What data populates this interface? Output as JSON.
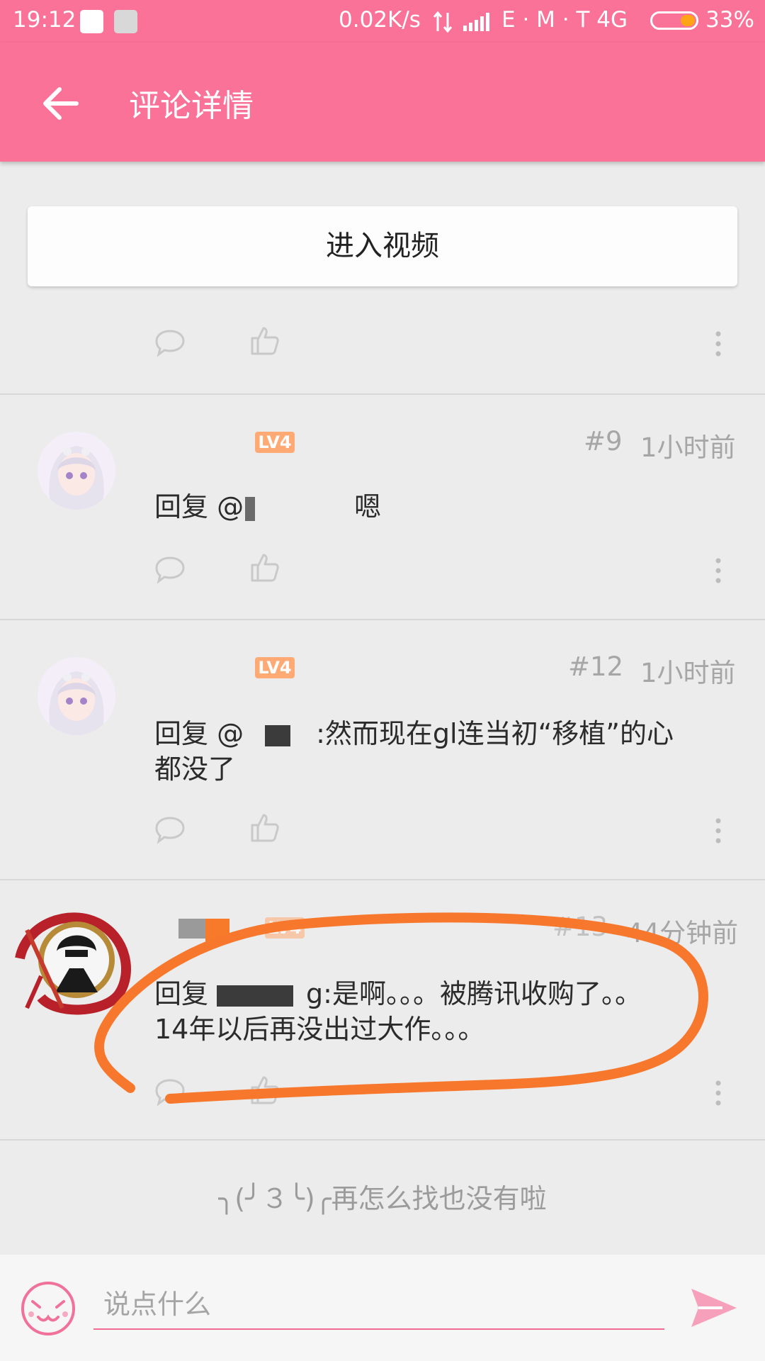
{
  "status_bar": {
    "time": "19:12",
    "net_speed": "0.02K/s",
    "carrier": "E · M · T 4G",
    "battery": "33%",
    "battery_level": 0.33,
    "accent": "#ffa317"
  },
  "app_bar": {
    "title": "评论详情",
    "back_icon": "back-arrow-icon",
    "color": "#fa7298"
  },
  "enter_video_label": "进入视频",
  "comments": [
    {
      "floor": "#9",
      "time": "1小时前",
      "level": "LV4",
      "text_prefix": "回复 @",
      "text_suffix": "嗯"
    },
    {
      "floor": "#12",
      "time": "1小时前",
      "level": "LV4",
      "text_prefix": "回复 @",
      "text_suffix": ":然而现在gl连当初“移植”的心",
      "text_line2": "都没了"
    },
    {
      "floor": "#13",
      "time": "44分钟前",
      "level": "LV4",
      "text_prefix": "回复",
      "text_suffix": "g:是啊。。。被腾讯收购了。。",
      "text_line2": "14年以后再没出过大作。。。"
    }
  ],
  "end_note": "╮(╯３╰)╭再怎么找也没有啦",
  "input": {
    "placeholder": "说点什么"
  },
  "icons": {
    "emoji": "emoji-face-icon",
    "send": "send-icon",
    "reply": "comment-bubble-icon",
    "like": "thumbs-up-icon",
    "more": "more-vertical-icon"
  }
}
